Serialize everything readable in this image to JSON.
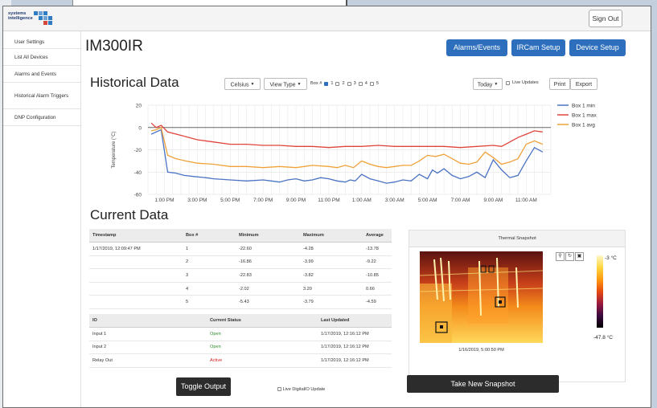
{
  "brand": {
    "logo_text_1": "systems",
    "logo_text_2": "intelligence"
  },
  "header": {
    "signout_label": "Sign Out"
  },
  "sidebar": {
    "items": [
      {
        "label": "User Settings"
      },
      {
        "label": "List All Devices"
      },
      {
        "label": "Alarms and Events"
      },
      {
        "label": "Historical Alarm Triggers"
      },
      {
        "label": "DNP Configuration"
      }
    ]
  },
  "device": {
    "title": "IM300IR"
  },
  "nav_buttons": {
    "alarms": "Alarms/Events",
    "ircam": "IRCam Setup",
    "device_setup": "Device Setup"
  },
  "historical": {
    "title": "Historical Data",
    "unit_select": "Celsius",
    "view_type": "View Type",
    "box_label": "Box #",
    "boxes": [
      "1",
      "2",
      "3",
      "4",
      "5"
    ],
    "box_checked": [
      true,
      false,
      false,
      false,
      false
    ],
    "range_select": "Today",
    "live_updates_label": "Live Updates",
    "print_label": "Print",
    "export_label": "Export"
  },
  "chart_data": {
    "type": "line",
    "title": "",
    "ylabel": "Temperature (°C)",
    "xlabel": "",
    "ylim": [
      -60,
      20
    ],
    "yticks": [
      20,
      0,
      -20,
      -40,
      -60
    ],
    "xlim": [
      12.0,
      36.5
    ],
    "x_tick_labels": [
      "1:00 PM",
      "3:00 PM",
      "5:00 PM",
      "7:00 PM",
      "9:00 PM",
      "11:00 PM",
      "1:00 AM",
      "3:00 AM",
      "5:00 AM",
      "7:00 AM",
      "9:00 AM",
      "11:00 AM"
    ],
    "x_tick_hours": [
      13,
      15,
      17,
      19,
      21,
      23,
      25,
      27,
      29,
      31,
      33,
      35
    ],
    "legend_position": "top-right",
    "series": [
      {
        "name": "Box 1 min",
        "color": "#4a72c4",
        "x": [
          12.2,
          12.5,
          12.8,
          13.2,
          13.7,
          14.2,
          14.8,
          15.5,
          16,
          17,
          18,
          19,
          19.5,
          20,
          20.5,
          21,
          21.5,
          22,
          22.5,
          23,
          23.5,
          24,
          24.3,
          24.6,
          25,
          25.5,
          26,
          26.5,
          27,
          27.5,
          28,
          28.5,
          29,
          29.3,
          29.6,
          30,
          30.5,
          31,
          31.5,
          32,
          32.5,
          33,
          33.5,
          34,
          34.5,
          35,
          35.5,
          36
        ],
        "values": [
          -6,
          -4,
          -2,
          -40,
          -41,
          -43,
          -44,
          -45,
          -46,
          -47,
          -48,
          -47,
          -48,
          -49,
          -47,
          -46,
          -48,
          -47,
          -45,
          -46,
          -48,
          -49,
          -47,
          -48,
          -42,
          -46,
          -48,
          -50,
          -49,
          -47,
          -48,
          -42,
          -46,
          -38,
          -41,
          -37,
          -43,
          -46,
          -44,
          -40,
          -45,
          -29,
          -38,
          -45,
          -43,
          -30,
          -18,
          -22
        ]
      },
      {
        "name": "Box 1 max",
        "color": "#e0453c",
        "x": [
          12.2,
          12.5,
          12.8,
          13.2,
          14,
          15,
          16,
          17,
          18,
          19,
          20,
          21,
          22,
          23,
          24,
          25,
          26,
          27,
          28,
          29,
          30,
          31,
          32,
          33,
          33.5,
          34,
          34.5,
          35,
          35.5,
          36
        ],
        "values": [
          4,
          0,
          2,
          -4,
          -7,
          -11,
          -13,
          -15,
          -15,
          -16,
          -16,
          -17,
          -17,
          -18,
          -17,
          -17,
          -16,
          -17,
          -17,
          -17,
          -17,
          -18,
          -17,
          -16,
          -17,
          -13,
          -9,
          -6,
          -3,
          -4
        ]
      },
      {
        "name": "Box 1 avg",
        "color": "#f0a23a",
        "x": [
          12.2,
          12.5,
          12.8,
          13.2,
          13.7,
          14.3,
          15,
          16,
          17,
          18,
          19,
          20,
          21,
          22,
          23,
          23.5,
          24,
          24.5,
          25,
          25.5,
          26,
          26.5,
          27,
          27.5,
          28,
          28.5,
          29,
          29.5,
          30,
          30.5,
          31,
          31.5,
          32,
          32.5,
          33,
          33.5,
          34,
          34.5,
          35,
          35.5,
          36
        ],
        "values": [
          -3,
          -2,
          0,
          -25,
          -28,
          -30,
          -32,
          -33,
          -35,
          -35,
          -36,
          -35,
          -36,
          -34,
          -35,
          -36,
          -34,
          -36,
          -30,
          -33,
          -35,
          -36,
          -35,
          -34,
          -34,
          -30,
          -25,
          -26,
          -24,
          -28,
          -32,
          -33,
          -31,
          -22,
          -27,
          -33,
          -31,
          -28,
          -15,
          -12,
          -15
        ]
      }
    ]
  },
  "current": {
    "title": "Current Data",
    "headers": [
      "Timestamp",
      "Box #",
      "Minimum",
      "Maximum",
      "Average"
    ],
    "timestamp": "1/17/2019, 12:09:47 PM",
    "rows": [
      {
        "box": "1",
        "min": "-22.60",
        "max": "-4.28",
        "avg": "-13.78"
      },
      {
        "box": "2",
        "min": "-16.86",
        "max": "-3.99",
        "avg": "-9.22"
      },
      {
        "box": "3",
        "min": "-22.83",
        "max": "-3.82",
        "avg": "-10.85"
      },
      {
        "box": "4",
        "min": "-2.02",
        "max": "3.20",
        "avg": "0.66"
      },
      {
        "box": "5",
        "min": "-5.43",
        "max": "-3.79",
        "avg": "-4.59"
      }
    ]
  },
  "io": {
    "headers": [
      "IO",
      "Current Status",
      "Last Updated"
    ],
    "rows": [
      {
        "name": "Input 1",
        "status": "Open",
        "updated": "1/17/2019, 12:16:12 PM"
      },
      {
        "name": "Input 2",
        "status": "Open",
        "updated": "1/17/2019, 12:16:12 PM"
      },
      {
        "name": "Relay Out",
        "status": "Active",
        "updated": "1/17/2019, 12:16:12 PM"
      }
    ],
    "toggle_label": "Toggle Output",
    "live_io_label": "Live DigitalIO Update"
  },
  "snapshot": {
    "title": "Thermal Snapshot",
    "timestamp": "1/16/2019, 5:00:50 PM",
    "scale_max": "-3 °C",
    "scale_min": "-47.8 °C",
    "take_label": "Take New Snapshot",
    "tools": [
      "zoom-icon",
      "refresh-icon",
      "image-icon"
    ]
  }
}
